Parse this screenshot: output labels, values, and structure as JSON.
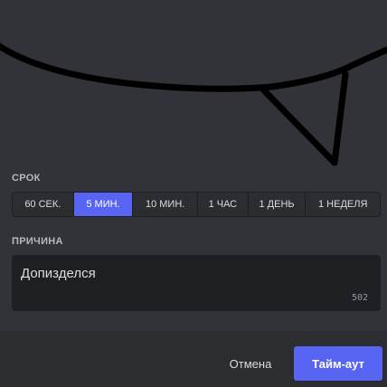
{
  "duration": {
    "label": "СРОК",
    "options": [
      "60 СЕК.",
      "5 МИН.",
      "10 МИН.",
      "1 ЧАС",
      "1 ДЕНЬ",
      "1 НЕДЕЛЯ"
    ],
    "selected_index": 1
  },
  "reason": {
    "label": "ПРИЧИНА",
    "value": "Допизделся",
    "remaining_chars": "502"
  },
  "footer": {
    "cancel_label": "Отмена",
    "timeout_label": "Тайм-аут"
  },
  "colors": {
    "accent": "#5865f2",
    "background": "#313338",
    "footer": "#2b2d31",
    "input": "#1e1f22"
  }
}
